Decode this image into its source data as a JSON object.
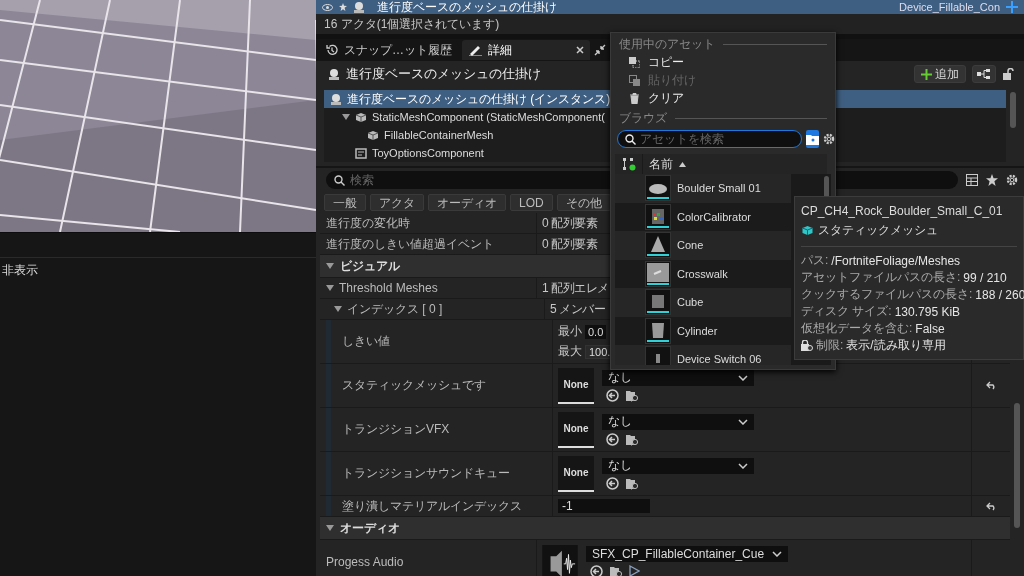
{
  "viewport": {
    "kind": "picture"
  },
  "left_panel": {
    "label": "非表示"
  },
  "outliner": {
    "row": {
      "name": "進行度ベースのメッシュの仕掛け",
      "type": "Device_Fillable_Con",
      "selected": true
    },
    "status": "16 アクタ(1個選択されています)"
  },
  "tabs": [
    {
      "label": "スナップ…ット履歴",
      "kind": "history",
      "selected": false,
      "closable": false
    },
    {
      "label": "詳細",
      "kind": "details",
      "selected": true,
      "closable": true
    }
  ],
  "actor": {
    "name": "進行度ベースのメッシュの仕掛け",
    "add_button": "追加"
  },
  "components": [
    {
      "label": "進行度ベースのメッシュの仕掛け (インスタンス)",
      "kind": "actor",
      "selected": true,
      "children": [
        {
          "label": "StaticMeshComponent (StaticMeshComponent(",
          "kind": "mesh",
          "selected": false,
          "children": [
            {
              "label": "FillableContainerMesh",
              "kind": "mesh",
              "selected": false
            }
          ]
        },
        {
          "label": "ToyOptionsComponent",
          "kind": "options",
          "selected": false
        }
      ]
    }
  ],
  "search": {
    "placeholder": "検索"
  },
  "filters": [
    "一般",
    "アクタ",
    "オーディオ",
    "LOD",
    "その他"
  ],
  "properties": [
    {
      "kind": "text",
      "name": "進行度の変化時",
      "value": "0 配列要素"
    },
    {
      "kind": "text",
      "name": "進行度のしきい値超過イベント",
      "value": "0 配列要素"
    },
    {
      "kind": "category",
      "name": "ビジュアル",
      "children": [
        {
          "kind": "text",
          "name": "Threshold Meshes",
          "value": "1 配列エレメ",
          "children": [
            {
              "kind": "text",
              "name": "インデックス [ 0 ]",
              "value": "5 メンバー",
              "children": [
                {
                  "kind": "range",
                  "name": "しきい値",
                  "min_label": "最小",
                  "min": "0.0",
                  "max_label": "最大",
                  "max": "100."
                },
                {
                  "kind": "asset",
                  "name": "スタティックメッシュです",
                  "thumbnail": {
                    "kind": "empty",
                    "label": "None"
                  },
                  "value": "なし",
                  "playable": false,
                  "resettable": true
                },
                {
                  "kind": "asset",
                  "name": "トランジションVFX",
                  "thumbnail": {
                    "kind": "empty",
                    "label": "None"
                  },
                  "value": "なし",
                  "playable": false,
                  "resettable": false
                },
                {
                  "kind": "asset",
                  "name": "トランジションサウンドキュー",
                  "thumbnail": {
                    "kind": "empty",
                    "label": "None"
                  },
                  "value": "なし",
                  "playable": false,
                  "resettable": false
                },
                {
                  "kind": "number",
                  "name": "塗り潰しマテリアルインデックス",
                  "value": "-1",
                  "resettable": true
                }
              ]
            }
          ]
        }
      ]
    },
    {
      "kind": "category",
      "name": "オーディオ",
      "children": [
        {
          "kind": "asset",
          "name": "Progess Audio",
          "thumbnail": {
            "kind": "sound"
          },
          "value": "SFX_CP_FillableContainer_Cue",
          "playable": true,
          "resettable": false
        }
      ]
    }
  ],
  "asset_picker": {
    "section_in_use": "使用中のアセット",
    "actions": [
      {
        "label": "コピー",
        "kind": "copy",
        "disabled": false
      },
      {
        "label": "貼り付け",
        "kind": "paste",
        "disabled": true
      },
      {
        "label": "クリア",
        "kind": "clear",
        "disabled": false
      }
    ],
    "section_browse": "ブラウズ",
    "search": {
      "placeholder": "アセットを検索"
    },
    "column": "名前",
    "assets": [
      {
        "name": "Boulder Small 01"
      },
      {
        "name": "ColorCalibrator"
      },
      {
        "name": "Cone"
      },
      {
        "name": "Crosswalk"
      },
      {
        "name": "Cube"
      },
      {
        "name": "Cylinder"
      },
      {
        "name": "Device Switch 06"
      }
    ]
  },
  "tooltip": {
    "title": "CP_CH4_Rock_Boulder_Small_C_01",
    "type": "スタティックメッシュ",
    "details": [
      {
        "kind": "info",
        "label": "パス:",
        "value": "/FortniteFoliage/Meshes"
      },
      {
        "kind": "info",
        "label": "アセットファイルパスの長さ:",
        "value": "99 / 210"
      },
      {
        "kind": "info",
        "label": "クックするファイルパスの長さ:",
        "value": "188 / 260"
      },
      {
        "kind": "info",
        "label": "ディスク サイズ:",
        "value": "130.795 KiB"
      },
      {
        "kind": "info",
        "label": "仮想化データを含む:",
        "value": "False"
      },
      {
        "kind": "restriction",
        "label": "制限:",
        "value": "表示/読み取り専用"
      }
    ]
  }
}
